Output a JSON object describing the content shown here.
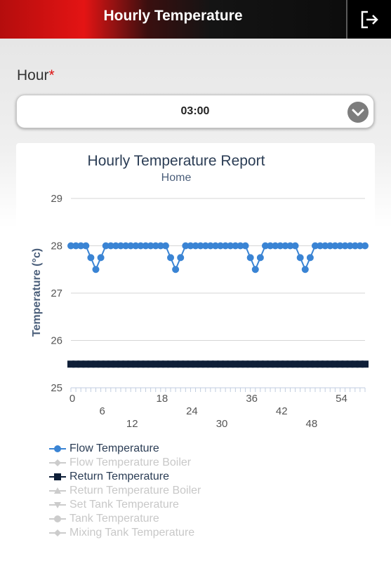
{
  "header": {
    "title": "Hourly Temperature",
    "logout_icon": "logout-icon"
  },
  "form": {
    "hour_label": "Hour",
    "required_mark": "*",
    "hour_value": "03:00",
    "dropdown_icon": "chevron-down-circle-icon"
  },
  "colors": {
    "flow": "#3a84d4",
    "return": "#0f1f38",
    "inactive": "#cccccc",
    "grid": "#d6d6d6",
    "brand_red": "#e41414"
  },
  "chart_data": {
    "type": "line",
    "title": "Hourly Temperature Report",
    "subtitle": "Home",
    "xlabel": "",
    "ylabel": "Temperature (°c)",
    "ylim": [
      25,
      29
    ],
    "xlim": [
      0,
      59
    ],
    "yticks": [
      25,
      26,
      27,
      28,
      29
    ],
    "xticks": [
      0,
      6,
      12,
      18,
      24,
      30,
      36,
      42,
      48,
      54
    ],
    "x": [
      0,
      1,
      2,
      3,
      4,
      5,
      6,
      7,
      8,
      9,
      10,
      11,
      12,
      13,
      14,
      15,
      16,
      17,
      18,
      19,
      20,
      21,
      22,
      23,
      24,
      25,
      26,
      27,
      28,
      29,
      30,
      31,
      32,
      33,
      34,
      35,
      36,
      37,
      38,
      39,
      40,
      41,
      42,
      43,
      44,
      45,
      46,
      47,
      48,
      49,
      50,
      51,
      52,
      53,
      54,
      55,
      56,
      57,
      58,
      59
    ],
    "series": [
      {
        "name": "Flow Temperature",
        "values": [
          28,
          28,
          28,
          28,
          27.75,
          27.5,
          27.75,
          28,
          28,
          28,
          28,
          28,
          28,
          28,
          28,
          28,
          28,
          28,
          28,
          28,
          27.75,
          27.5,
          27.75,
          28,
          28,
          28,
          28,
          28,
          28,
          28,
          28,
          28,
          28,
          28,
          28,
          28,
          27.75,
          27.5,
          27.75,
          28,
          28,
          28,
          28,
          28,
          28,
          28,
          27.75,
          27.5,
          27.75,
          28,
          28,
          28,
          28,
          28,
          28,
          28,
          28,
          28,
          28,
          28
        ]
      },
      {
        "name": "Return Temperature",
        "values": [
          25.5,
          25.5,
          25.5,
          25.5,
          25.5,
          25.5,
          25.5,
          25.5,
          25.5,
          25.5,
          25.5,
          25.5,
          25.5,
          25.5,
          25.5,
          25.5,
          25.5,
          25.5,
          25.5,
          25.5,
          25.5,
          25.5,
          25.5,
          25.5,
          25.5,
          25.5,
          25.5,
          25.5,
          25.5,
          25.5,
          25.5,
          25.5,
          25.5,
          25.5,
          25.5,
          25.5,
          25.5,
          25.5,
          25.5,
          25.5,
          25.5,
          25.5,
          25.5,
          25.5,
          25.5,
          25.5,
          25.5,
          25.5,
          25.5,
          25.5,
          25.5,
          25.5,
          25.5,
          25.5,
          25.5,
          25.5,
          25.5,
          25.5,
          25.5,
          25.5
        ]
      }
    ],
    "legend": [
      {
        "name": "Flow Temperature",
        "active": true,
        "symbol": "circle"
      },
      {
        "name": "Flow Temperature Boiler",
        "active": false,
        "symbol": "diamond"
      },
      {
        "name": "Return Temperature",
        "active": true,
        "symbol": "square"
      },
      {
        "name": "Return Temperature Boiler",
        "active": false,
        "symbol": "triangle"
      },
      {
        "name": "Set Tank Temperature",
        "active": false,
        "symbol": "triangle-down"
      },
      {
        "name": "Tank Temperature",
        "active": false,
        "symbol": "circle"
      },
      {
        "name": "Mixing Tank Temperature",
        "active": false,
        "symbol": "diamond"
      }
    ],
    "legend_position": "bottom-left",
    "grid": true
  }
}
